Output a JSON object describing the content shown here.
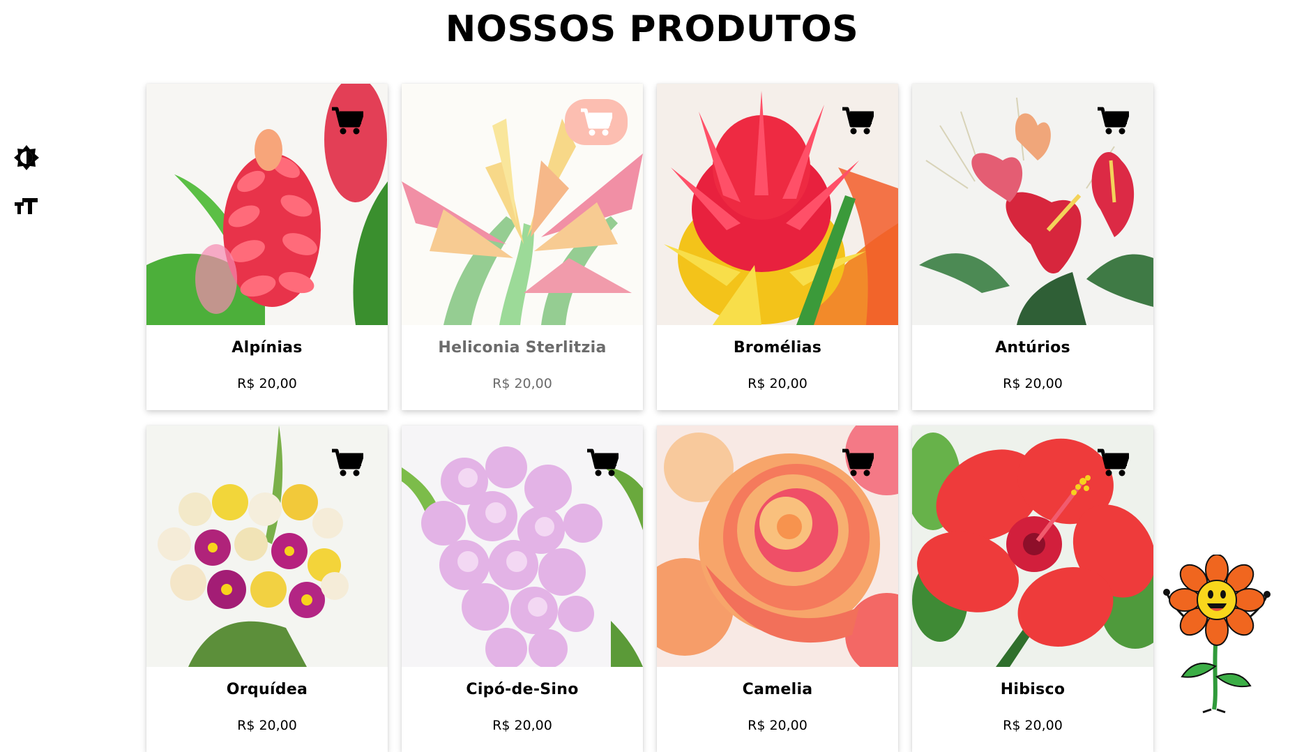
{
  "page": {
    "title": "NOSSOS PRODUTOS"
  },
  "tools": [
    {
      "name": "contrast-toggle",
      "icon": "contrast-icon"
    },
    {
      "name": "font-size-toggle",
      "icon": "text-size-icon"
    }
  ],
  "cart_icon": "cart-icon",
  "colors": {
    "cart_active_bg": "#fb8a72",
    "card_shadow": "rgba(0,0,0,0.18)"
  },
  "products": [
    {
      "name": "Alpínias",
      "price": "R$ 20,00"
    },
    {
      "name": "Heliconia Sterlitzia",
      "price": "R$ 20,00",
      "state": "hovered"
    },
    {
      "name": "Bromélias",
      "price": "R$ 20,00"
    },
    {
      "name": "Antúrios",
      "price": "R$ 20,00"
    },
    {
      "name": "Orquídea",
      "price": "R$ 20,00"
    },
    {
      "name": "Cipó-de-Sino",
      "price": "R$ 20,00"
    },
    {
      "name": "Camelia",
      "price": "R$ 20,00"
    },
    {
      "name": "Hibisco",
      "price": "R$ 20,00"
    }
  ],
  "mascot": {
    "icon": "flower-mascot-icon"
  }
}
